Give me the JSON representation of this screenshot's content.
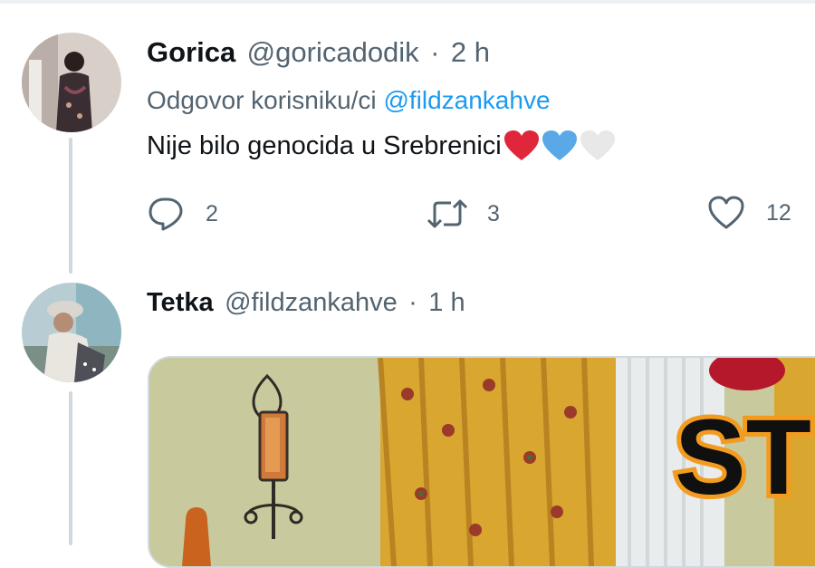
{
  "tweet1": {
    "name": "Gorica",
    "handle": "@goricadodik",
    "separator": "·",
    "time": "2 h",
    "reply_prefix": "Odgovor korisniku/ci",
    "reply_mention": "@fildzankahve",
    "text": "Nije bilo genocida u Srebrenici",
    "emojis": [
      "red-heart",
      "blue-heart",
      "white-heart"
    ],
    "reply_count": "2",
    "retweet_count": "3",
    "like_count": "12"
  },
  "tweet2": {
    "name": "Tetka",
    "handle": "@fildzankahve",
    "separator": "·",
    "time": "1 h",
    "media_text": "ST"
  },
  "colors": {
    "accent": "#1d9bf0",
    "secondary_text": "#536471",
    "primary_text": "#0f1419",
    "red_heart": "#e0263a",
    "blue_heart": "#5aa9e6",
    "white_heart": "#e8e8e8"
  },
  "icons": [
    "reply-icon",
    "retweet-icon",
    "like-icon"
  ]
}
